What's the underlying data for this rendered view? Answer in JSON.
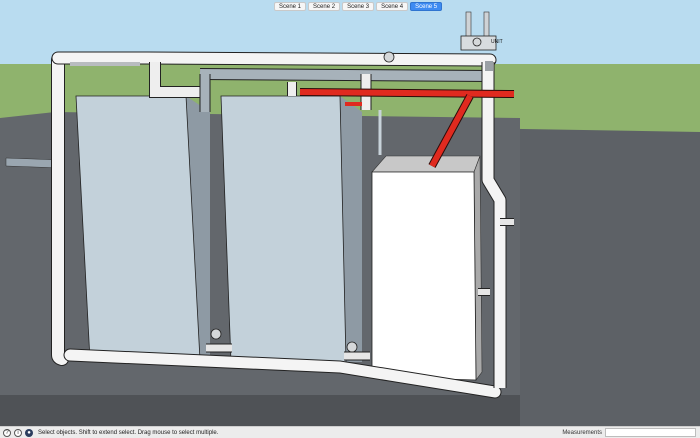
{
  "scene_tabs": [
    {
      "label": "Scene 1",
      "active": false
    },
    {
      "label": "Scene 2",
      "active": false
    },
    {
      "label": "Scene 3",
      "active": false
    },
    {
      "label": "Scene 4",
      "active": false
    },
    {
      "label": "Scene 5",
      "active": true
    }
  ],
  "viewport": {
    "label_tag": "UNIT",
    "colors": {
      "sky": "#b9dcf0",
      "grass": "#8fb36d",
      "ground": "#5d6166",
      "pipe_white": "#f4f4f4",
      "pipe_red": "#e02a1f",
      "unit_blue": "#c3d1da",
      "unit_white": "#ffffff"
    }
  },
  "status": {
    "icons": [
      "help-icon",
      "info-icon",
      "user-icon"
    ],
    "message": "Select objects. Shift to extend select. Drag mouse to select multiple.",
    "measurements_label": "Measurements",
    "measurements_value": ""
  }
}
